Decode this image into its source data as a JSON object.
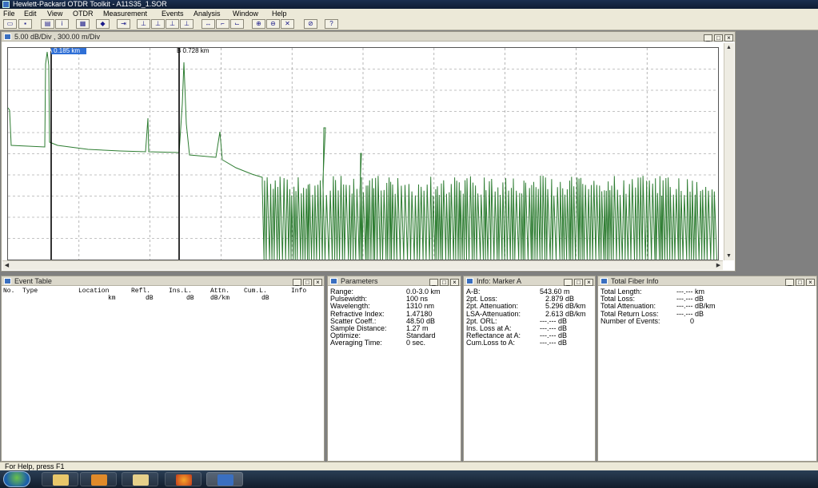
{
  "app": {
    "title": "Hewlett-Packard OTDR Toolkit - A11S35_1.SOR"
  },
  "menu": [
    "File",
    "Edit",
    "View",
    "OTDR",
    "Measurement",
    "Events",
    "Analysis",
    "Window",
    "Help"
  ],
  "trace_window": {
    "title": "5.00 dB/Div , 300.00 m/Div",
    "marker_a": "A 0.185 km",
    "marker_b": "B 0.728 km"
  },
  "event_table": {
    "title": "Event Table",
    "columns": [
      "No.",
      "Type",
      "Location",
      "Refl.",
      "Ins.L.",
      "Attn.",
      "Cum.L.",
      "Info"
    ],
    "units": [
      "",
      "",
      "km",
      "dB",
      "dB",
      "dB/km",
      "dB",
      ""
    ]
  },
  "parameters": {
    "title": "Parameters",
    "rows": [
      {
        "label": "Range:",
        "value": "0.0-3.0 km"
      },
      {
        "label": "Pulsewidth:",
        "value": "100 ns"
      },
      {
        "label": "Wavelength:",
        "value": "1310 nm"
      },
      {
        "label": "Refractive Index:",
        "value": "1.47180"
      },
      {
        "label": "Scatter Coeff.:",
        "value": "48.50 dB"
      },
      {
        "label": "Sample Distance:",
        "value": "1.27 m"
      },
      {
        "label": "Optimize:",
        "value": "Standard"
      },
      {
        "label": "Averaging Time:",
        "value": "0 sec."
      }
    ]
  },
  "info_marker": {
    "title": "Info: Marker A",
    "rows": [
      {
        "label": "A-B:",
        "value": "543.60 m"
      },
      {
        "label": "2pt. Loss:",
        "value": "2.879 dB"
      },
      {
        "label": "2pt. Attenuation:",
        "value": "5.296 dB/km"
      },
      {
        "label": "LSA-Attenuation:",
        "value": "2.613 dB/km"
      },
      {
        "label": "2pt. ORL:",
        "value": "---.--- dB"
      },
      {
        "label": "Ins. Loss at A:",
        "value": "---.--- dB"
      },
      {
        "label": "Reflectance at A:",
        "value": "---.--- dB"
      },
      {
        "label": "Cum.Loss to A:",
        "value": "---.--- dB"
      }
    ]
  },
  "total_fiber": {
    "title": "Total Fiber Info",
    "rows": [
      {
        "label": "Total Length:",
        "value": "---.--- km"
      },
      {
        "label": "Total Loss:",
        "value": "---.--- dB"
      },
      {
        "label": "Total Attenuation:",
        "value": "---.--- dB/km"
      },
      {
        "label": "Total Return Loss:",
        "value": "---.--- dB"
      },
      {
        "label": "Number of Events:",
        "value": "0"
      }
    ]
  },
  "status": {
    "text": "For Help, press F1"
  },
  "colors": {
    "trace": "#2e7d32",
    "marker_highlight": "#2f6fd6"
  }
}
